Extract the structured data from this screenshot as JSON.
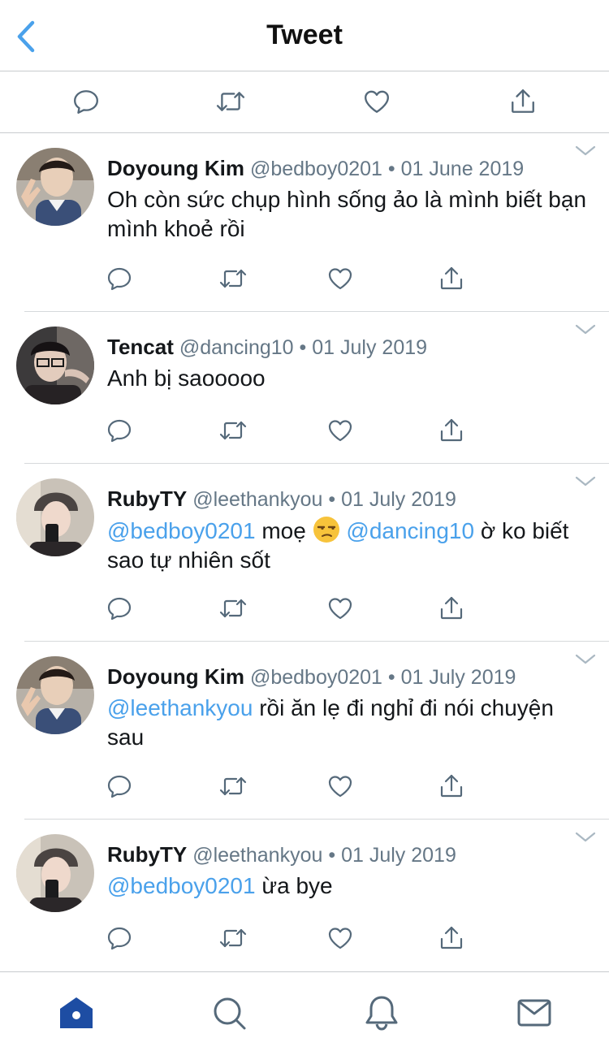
{
  "header": {
    "title": "Tweet",
    "back_icon": "chevron-left-icon",
    "accent": "#4aa1eb"
  },
  "top_actions": [
    "reply-icon",
    "retweet-icon",
    "like-icon",
    "share-icon"
  ],
  "tweets": [
    {
      "name": "Doyoung Kim",
      "handle": "@bedboy0201",
      "dot": "•",
      "date": "01 June 2019",
      "text_pre": "Oh còn sức chụp hình sống ảo là mình biết bạn mình khoẻ rồi"
    },
    {
      "name": "Tencat",
      "handle": "@dancing10",
      "dot": "•",
      "date": "01 July 2019",
      "text_pre": "Anh bị saooooo"
    },
    {
      "name": "RubyTY",
      "handle": "@leethankyou",
      "dot": "•",
      "date": "01 July 2019",
      "mention1": "@bedboy0201",
      "text_mid": " moẹ ",
      "emoji": "unamused-face-emoji",
      "mention2": "@dancing10",
      "text_post": " ờ ko biết sao tự nhiên sốt"
    },
    {
      "name": "Doyoung Kim",
      "handle": "@bedboy0201",
      "dot": "•",
      "date": "01 July 2019",
      "mention1": "@leethankyou",
      "text_post": " rồi ăn lẹ đi nghỉ đi nói chuyện sau"
    },
    {
      "name": "RubyTY",
      "handle": "@leethankyou",
      "dot": "•",
      "date": "01 July 2019",
      "mention1": "@bedboy0201",
      "text_post": " ừa bye"
    }
  ],
  "tabbar": {
    "items": [
      "home-icon",
      "search-icon",
      "notifications-icon",
      "messages-icon"
    ],
    "active_color": "#1d4da3"
  },
  "colors": {
    "mention": "#4aa1eb",
    "muted": "#657786",
    "icon": "#55697a"
  }
}
